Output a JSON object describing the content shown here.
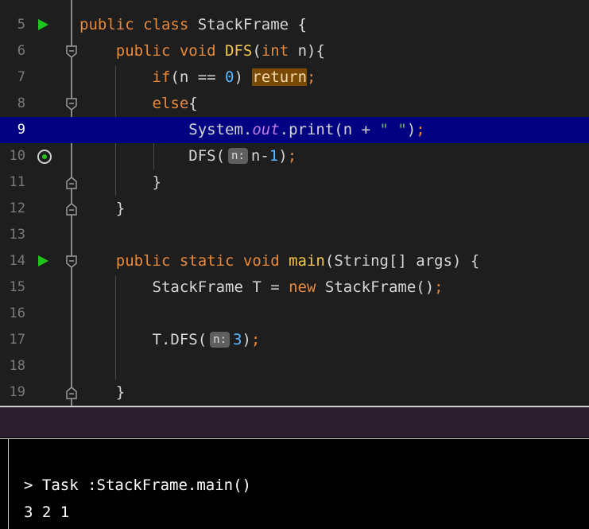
{
  "editor": {
    "lines": [
      {
        "num": "5",
        "code": "public class StackFrame {"
      },
      {
        "num": "6",
        "code": "    public void DFS(int n){"
      },
      {
        "num": "7",
        "code": "        if(n == 0) return;"
      },
      {
        "num": "8",
        "code": "        else{"
      },
      {
        "num": "9",
        "code": "            System.out.print(n + \" \");"
      },
      {
        "num": "10",
        "code": "            DFS(n: n-1);"
      },
      {
        "num": "11",
        "code": "        }"
      },
      {
        "num": "12",
        "code": "    }"
      },
      {
        "num": "13",
        "code": ""
      },
      {
        "num": "14",
        "code": "    public static void main(String[] args) {"
      },
      {
        "num": "15",
        "code": "        StackFrame T = new StackFrame();"
      },
      {
        "num": "16",
        "code": ""
      },
      {
        "num": "17",
        "code": "        T.DFS(n: 3);"
      },
      {
        "num": "18",
        "code": ""
      },
      {
        "num": "19",
        "code": "    }"
      }
    ],
    "current_line": "9",
    "param_hint": "n:",
    "icons": {
      "run_gutter": "run-play-icon",
      "debug_frame": "restart-frame-icon",
      "fold": "fold-toggle-icon"
    },
    "colors": {
      "current_line_bg": "#000080",
      "keyword": "#e88a3a",
      "function": "#f1c74e",
      "number": "#59b8ff",
      "field": "#c17ce8",
      "return_highlight": "#7a4a00"
    }
  },
  "run_panel": {
    "command": "> Task :StackFrame.main()",
    "output": "3 2 1"
  }
}
